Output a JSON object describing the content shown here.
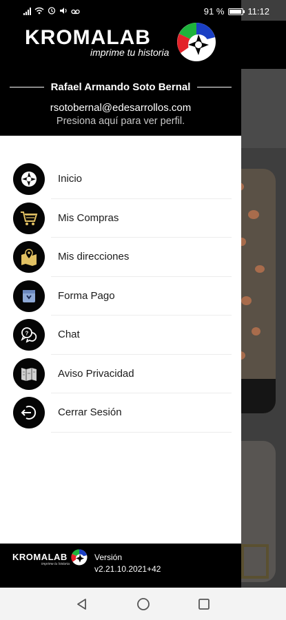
{
  "status_bar": {
    "battery_text": "91 %",
    "time": "11:12"
  },
  "header": {
    "brand": "KROMALAB",
    "tagline": "imprime tu historia",
    "user_name": "Rafael Armando Soto Bernal",
    "email": "rsotobernal@edesarrollos.com",
    "profile_link": "Presiona aquí para ver perfil."
  },
  "menu": {
    "items": [
      {
        "label": "Inicio",
        "icon": "camera-aperture-icon"
      },
      {
        "label": "Mis Compras",
        "icon": "shopping-cart-icon"
      },
      {
        "label": "Mis direcciones",
        "icon": "map-pin-icon"
      },
      {
        "label": "Forma Pago",
        "icon": "wallet-icon"
      },
      {
        "label": "Chat",
        "icon": "chat-bubbles-icon"
      },
      {
        "label": "Aviso Privacidad",
        "icon": "book-map-icon"
      },
      {
        "label": "Cerrar Sesión",
        "icon": "logout-icon"
      }
    ]
  },
  "footer": {
    "brand": "KROMALAB",
    "tagline": "imprime tu historia",
    "version_label": "Versión",
    "version_value": "v2.21.10.2021+42"
  },
  "colors": {
    "drawer_header_bg": "#000000",
    "menu_icon_bg": "#050505",
    "menu_icon_accent": "#e2c163",
    "logo_red": "#e32229",
    "logo_green": "#1db33b",
    "logo_blue": "#1a3fc4"
  }
}
